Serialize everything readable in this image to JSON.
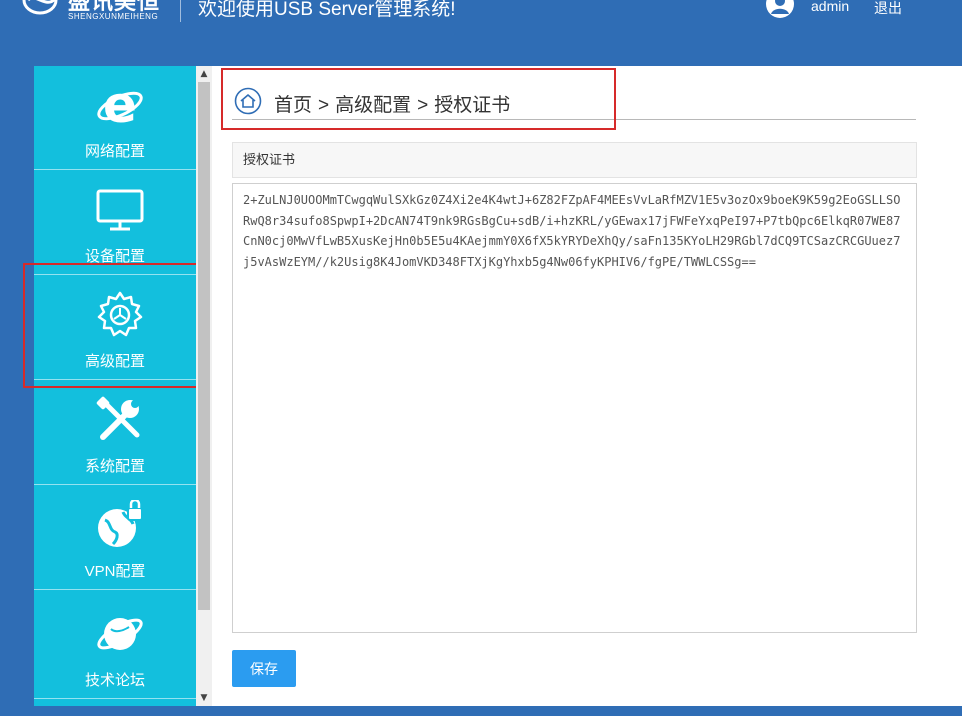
{
  "header": {
    "logo_name": "盛讯美恒",
    "logo_sub": "SHENGXUNMEIHENG",
    "title": "欢迎使用USB Server管理系统!",
    "username": "admin",
    "logout_label": "退出"
  },
  "sidebar": {
    "items": [
      {
        "label": "网络配置",
        "icon": "ie-browser-icon"
      },
      {
        "label": "设备配置",
        "icon": "monitor-icon"
      },
      {
        "label": "高级配置",
        "icon": "gear-icon",
        "active": true
      },
      {
        "label": "系统配置",
        "icon": "tools-icon"
      },
      {
        "label": "VPN配置",
        "icon": "vpn-globe-lock-icon"
      },
      {
        "label": "技术论坛",
        "icon": "planet-icon"
      }
    ]
  },
  "breadcrumb": {
    "home": "首页",
    "level1": "高级配置",
    "current": "授权证书",
    "separator": ">"
  },
  "panel": {
    "title": "授权证书",
    "certificate": "2+ZuLNJ0UOOMmTCwgqWulSXkGz0Z4Xi2e4K4wtJ+6Z82FZpAF4MEEsVvLaRfMZV1E5v3ozOx9boeK9K59g2EoGSLLSORwQ8r34sufo8SpwpI+2DcAN74T9nk9RGsBgCu+sdB/i+hzKRL/yGEwax17jFWFeYxqPeI97+P7tbQpc6ElkqR07WE87CnN0cj0MwVfLwB5XusKejHn0b5E5u4KAejmmY0X6fX5kYRYDeXhQy/saFn135KYoLH29RGbl7dCQ9TCSazCRCGUuez7j5vAsWzEYM//k2Usig8K4JomVKD348FTXjKgYhxb5g4Nw06fyKPHIV6/fgPE/TWWLCSSg=="
  },
  "actions": {
    "save_label": "保存"
  },
  "colors": {
    "header_bg": "#2f6db5",
    "sidebar_bg": "#13bfdd",
    "save_button": "#2b9cf0",
    "highlight_border": "#d62a2a"
  }
}
